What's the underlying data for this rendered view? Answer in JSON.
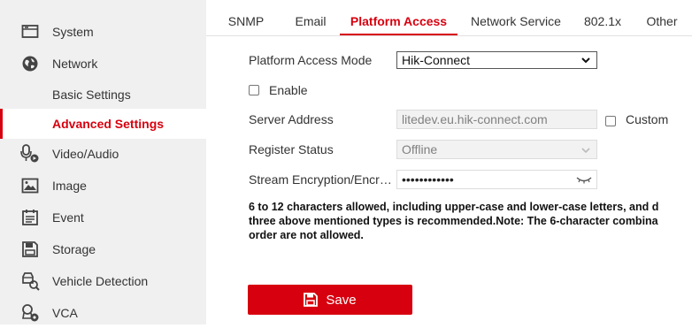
{
  "sidebar": {
    "items": [
      {
        "label": "System",
        "icon": "system-icon"
      },
      {
        "label": "Network",
        "icon": "network-icon"
      },
      {
        "label": "Basic Settings"
      },
      {
        "label": "Advanced Settings",
        "active": true
      },
      {
        "label": "Video/Audio",
        "icon": "video-audio-icon"
      },
      {
        "label": "Image",
        "icon": "image-icon"
      },
      {
        "label": "Event",
        "icon": "event-icon"
      },
      {
        "label": "Storage",
        "icon": "storage-icon"
      },
      {
        "label": "Vehicle Detection",
        "icon": "vehicle-detection-icon"
      },
      {
        "label": "VCA",
        "icon": "vca-icon"
      }
    ]
  },
  "tabs": [
    {
      "label": "SNMP"
    },
    {
      "label": "Email"
    },
    {
      "label": "Platform Access",
      "active": true
    },
    {
      "label": "Network Service"
    },
    {
      "label": "802.1x"
    },
    {
      "label": "Other"
    }
  ],
  "form": {
    "platform_access_mode_label": "Platform Access Mode",
    "platform_access_mode_value": "Hik-Connect",
    "enable_label": "Enable",
    "server_address_label": "Server Address",
    "server_address_value": "litedev.eu.hik-connect.com",
    "custom_label": "Custom",
    "register_status_label": "Register Status",
    "register_status_value": "Offline",
    "stream_encryption_label": "Stream Encryption/Encry…",
    "stream_encryption_value": "••••••••••••",
    "hint_line1": "6 to 12 characters allowed, including upper-case and lower-case letters, and d",
    "hint_line2": "three above mentioned types is recommended.Note: The 6-character combina",
    "hint_line3": "order are not allowed."
  },
  "actions": {
    "save_label": "Save"
  },
  "colors": {
    "accent": "#d7000f",
    "sidebar_bg": "#f0f0f0"
  }
}
